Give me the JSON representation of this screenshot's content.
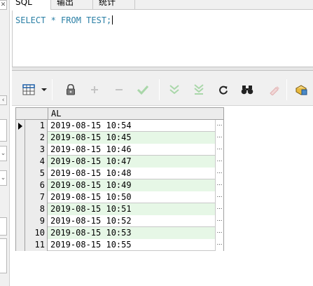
{
  "tabs": [
    {
      "label": "SQL",
      "active": true
    },
    {
      "label": "输出",
      "active": false
    },
    {
      "label": "统计",
      "active": false
    }
  ],
  "editor": {
    "sql": "SELECT * FROM TEST;",
    "keyword_color": "#2a7fa5"
  },
  "toolbar": {
    "buttons": [
      {
        "icon": "grid-select-icon",
        "enabled": true
      },
      {
        "icon": "dropdown-arrow-icon",
        "enabled": true
      },
      {
        "icon": "lock-icon",
        "enabled": true
      },
      {
        "icon": "add-record-icon",
        "enabled": false
      },
      {
        "icon": "delete-record-icon",
        "enabled": false
      },
      {
        "icon": "post-changes-icon",
        "enabled": false
      },
      {
        "icon": "fetch-next-page-icon",
        "enabled": false
      },
      {
        "icon": "fetch-last-page-icon",
        "enabled": false
      },
      {
        "icon": "refresh-icon",
        "enabled": true
      },
      {
        "icon": "find-binoculars-icon",
        "enabled": true
      },
      {
        "icon": "clear-filter-icon",
        "enabled": false
      },
      {
        "icon": "export-icon",
        "enabled": true
      }
    ]
  },
  "grid": {
    "columns": [
      "AL"
    ],
    "row_highlight_color": "#e6f7e6",
    "current_row": 1,
    "rows": [
      {
        "num": "1",
        "AL": "2019-08-15 10:54"
      },
      {
        "num": "2",
        "AL": "2019-08-15 10:45"
      },
      {
        "num": "3",
        "AL": "2019-08-15 10:46"
      },
      {
        "num": "4",
        "AL": "2019-08-15 10:47"
      },
      {
        "num": "5",
        "AL": "2019-08-15 10:48"
      },
      {
        "num": "6",
        "AL": "2019-08-15 10:49"
      },
      {
        "num": "7",
        "AL": "2019-08-15 10:50"
      },
      {
        "num": "8",
        "AL": "2019-08-15 10:51"
      },
      {
        "num": "9",
        "AL": "2019-08-15 10:52"
      },
      {
        "num": "10",
        "AL": "2019-08-15 10:53"
      },
      {
        "num": "11",
        "AL": "2019-08-15 10:55"
      }
    ],
    "cell_button_glyph": "…"
  }
}
